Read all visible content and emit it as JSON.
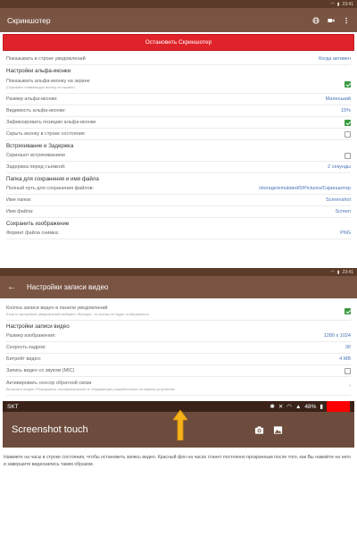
{
  "top": {
    "statusbar": {
      "time": "",
      "right_time": "23:41"
    },
    "appbar": {
      "title": "Скриншотер",
      "icons": [
        "globe-icon",
        "video-icon",
        "more-vert-icon"
      ]
    },
    "stop_button": "Остановить Скриншотер",
    "rows": [
      {
        "type": "row",
        "label": "Показывать в строке уведомлений",
        "value": "Когда активен"
      },
      {
        "type": "section",
        "label": "Настройки альфа-иконки"
      },
      {
        "type": "row",
        "label": "Показывать альфа-иконку на экране",
        "sub": "(Скрывает плавающую иконку на экране)",
        "check": true
      },
      {
        "type": "row",
        "label": "Размер альфа-иконки:",
        "value": "Маленький"
      },
      {
        "type": "row",
        "label": "Видимость альфа-иконки:",
        "value": "15%"
      },
      {
        "type": "row",
        "label": "Зафиксировать позицию альфа-иконки",
        "check": true
      },
      {
        "type": "row",
        "label": "Скрыть иконку в строке состояния",
        "check": false
      },
      {
        "type": "section",
        "label": "Встряхивание и Задержка"
      },
      {
        "type": "row",
        "label": "Скриншот встряхиванием",
        "check": false
      },
      {
        "type": "row",
        "label": "Задержка перед съемкой:",
        "value": "2 секунды"
      },
      {
        "type": "section",
        "label": "Папка для сохранения и имя файла"
      },
      {
        "type": "row",
        "label": "Полный путь для сохранения файлов:",
        "value": "/storage/emulated/0/Pictures/Скриншотер"
      },
      {
        "type": "row",
        "label": "Имя папки:",
        "value": "Screenshot"
      },
      {
        "type": "row",
        "label": "Имя файла:",
        "value": "Screen"
      },
      {
        "type": "section",
        "label": "Сохранить изображение"
      },
      {
        "type": "row",
        "label": "Формат файла снимка:",
        "value": "PNG"
      }
    ]
  },
  "bottom": {
    "statusbar": {
      "right_time": "23:41"
    },
    "appbar": {
      "back": "←",
      "title": "Настройки записи видео"
    },
    "rows": [
      {
        "type": "row",
        "label": "Кнопка записи видео в панели уведомлений",
        "sub": "Если в настройках уведомлений выбрано «Всегда», то кнопка не будет отображаться",
        "check": true
      },
      {
        "type": "section",
        "label": "Настройки записи видео"
      },
      {
        "type": "row",
        "label": "Размер изображения:",
        "value": "1280 x 1024"
      },
      {
        "type": "row",
        "label": "Скорость кадров:",
        "value": "30"
      },
      {
        "type": "row",
        "label": "Битрейт видео:",
        "value": "4 MB"
      },
      {
        "type": "row",
        "label": "Запись видео со звуком (MIC)",
        "check": false
      },
      {
        "type": "row",
        "label": "Активировать сенсор обратной связи",
        "sub": "Включите опцию «Показывать отклики/касания» в «Параметрах разработчика» на вашем устройстве",
        "value": "›"
      }
    ],
    "preview": {
      "carrier": "SKT",
      "battery": "48%",
      "title": "Screenshot touch"
    },
    "footer": "Нажмите на часы в строке состояния, чтобы остановить запись видео. Красный фон на часах станет постоянно прозрачным после того, как Вы нажмёте на него и завершите видеозапись таким образом."
  },
  "colors": {
    "appbar": "#7a5443",
    "statusbar": "#5b3a29",
    "stop": "#e0232a",
    "accent": "#4a73b8",
    "check": "#3a9a3f"
  }
}
